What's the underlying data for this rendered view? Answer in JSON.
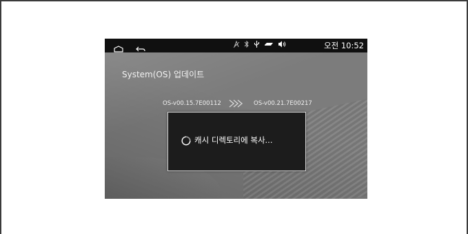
{
  "status_bar": {
    "time": "오전 10:52",
    "icons": [
      "gps-icon",
      "bluetooth-icon",
      "usb-icon",
      "battery-icon",
      "volume-icon"
    ]
  },
  "content": {
    "title": "System(OS) 업데이트",
    "version_from": "OS-v00.15.7E00112",
    "version_to": "OS-v00.21.7E00217"
  },
  "dialog": {
    "message": "캐시 디렉토리에 복사..."
  },
  "colors": {
    "statusbar_bg": "#101010",
    "screen_bg": "#7a7a7a",
    "dialog_bg": "#1c1c1c",
    "dialog_border": "#d8d8d8"
  }
}
